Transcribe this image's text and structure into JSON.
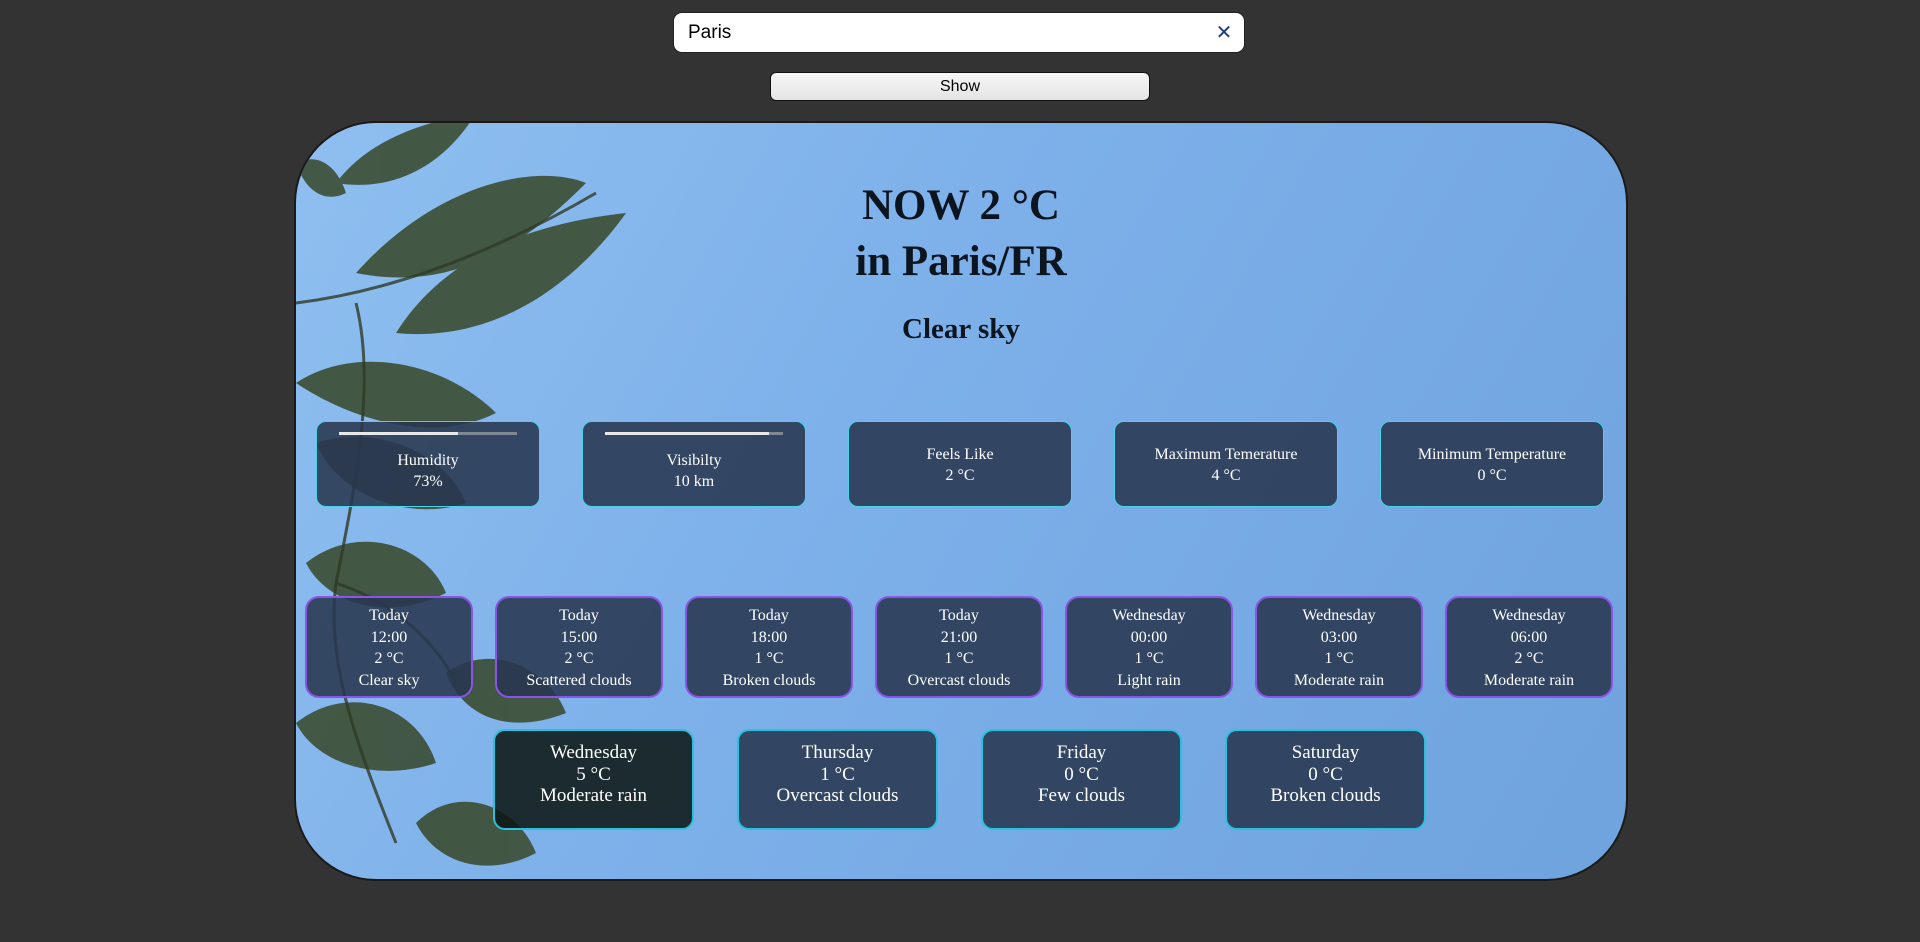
{
  "search": {
    "value": "Paris",
    "clear_symbol": "✕"
  },
  "show_button": {
    "label": "Show"
  },
  "current": {
    "title_line1": "NOW 2 °C",
    "title_line2": "in Paris/FR",
    "description": "Clear sky"
  },
  "stats": [
    {
      "label": "Humidity",
      "value": "73%",
      "bar_percent": 67
    },
    {
      "label": "Visibilty",
      "value": "10 km",
      "bar_percent": 92
    },
    {
      "label": "Feels Like",
      "value": "2 °C"
    },
    {
      "label": "Maximum Temerature",
      "value": "4 °C"
    },
    {
      "label": "Minimum Temperature",
      "value": "0 °C"
    }
  ],
  "hourly": [
    {
      "day": "Today",
      "time": "12:00",
      "temp": "2 °C",
      "desc": "Clear sky"
    },
    {
      "day": "Today",
      "time": "15:00",
      "temp": "2 °C",
      "desc": "Scattered clouds"
    },
    {
      "day": "Today",
      "time": "18:00",
      "temp": "1 °C",
      "desc": "Broken clouds"
    },
    {
      "day": "Today",
      "time": "21:00",
      "temp": "1 °C",
      "desc": "Overcast clouds"
    },
    {
      "day": "Wednesday",
      "time": "00:00",
      "temp": "1 °C",
      "desc": "Light rain"
    },
    {
      "day": "Wednesday",
      "time": "03:00",
      "temp": "1 °C",
      "desc": "Moderate rain"
    },
    {
      "day": "Wednesday",
      "time": "06:00",
      "temp": "2 °C",
      "desc": "Moderate rain"
    }
  ],
  "daily": [
    {
      "day": "Wednesday",
      "temp": "5 °C",
      "desc": "Moderate rain"
    },
    {
      "day": "Thursday",
      "temp": "1 °C",
      "desc": "Overcast clouds"
    },
    {
      "day": "Friday",
      "temp": "0 °C",
      "desc": "Few clouds"
    },
    {
      "day": "Saturday",
      "temp": "0 °C",
      "desc": "Broken clouds"
    }
  ],
  "colors": {
    "page_bg": "#333333",
    "stat_border": "#47d2e8",
    "hourly_border": "#8a55e6",
    "daily_border": "#27c3de",
    "card_bg": "#283750"
  }
}
